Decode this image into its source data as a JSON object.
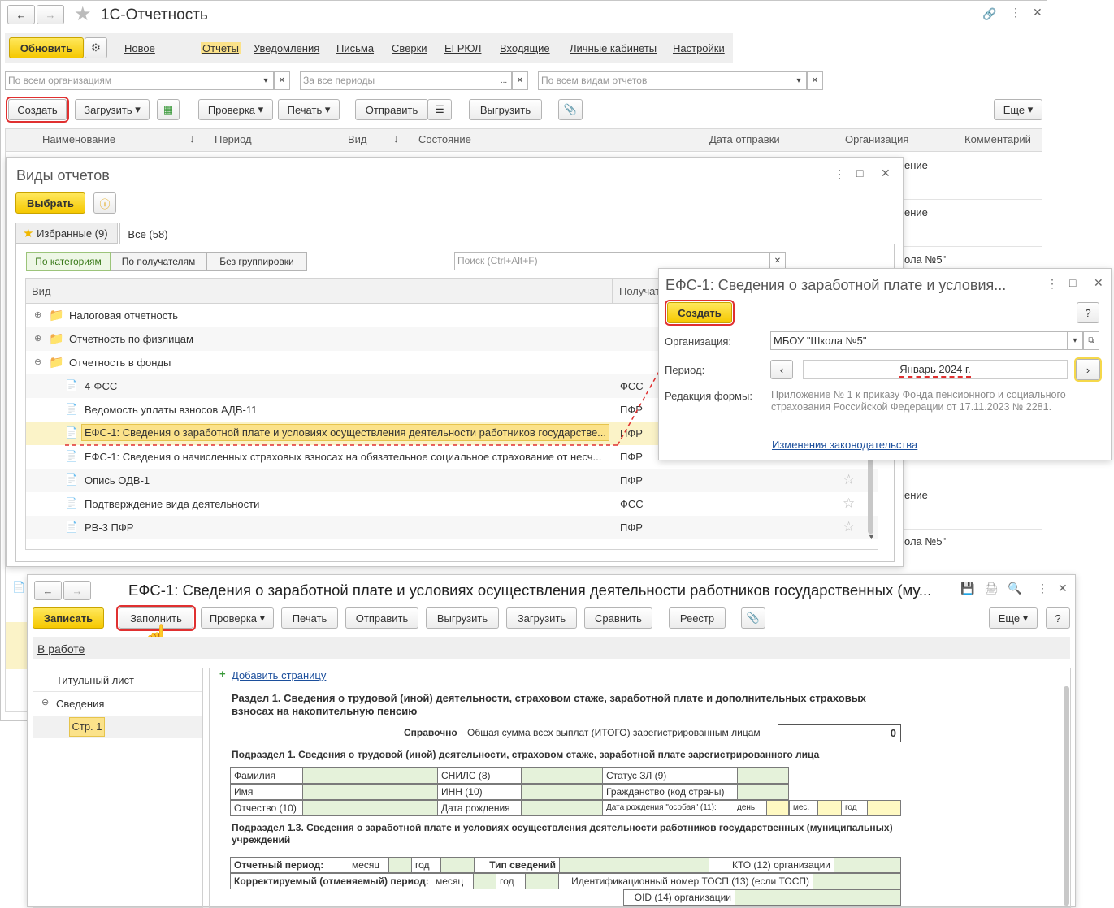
{
  "main": {
    "title": "1С-Отчетность",
    "refresh": "Обновить",
    "tabs": [
      "Новое",
      "Отчеты",
      "Уведомления",
      "Письма",
      "Сверки",
      "ЕГРЮЛ",
      "Входящие",
      "Личные кабинеты",
      "Настройки"
    ],
    "filters": {
      "org": "По всем организациям",
      "period": "За все периоды",
      "kind": "По всем видам отчетов"
    },
    "toolbar": {
      "create": "Создать",
      "load": "Загрузить",
      "check": "Проверка",
      "print": "Печать",
      "send": "Отправить",
      "export": "Выгрузить",
      "more": "Еще"
    },
    "columns": [
      "Наименование",
      "Период",
      "Вид",
      "Состояние",
      "Дата отправки",
      "Организация",
      "Комментарий"
    ],
    "right_fragments": [
      "ение",
      "ение",
      "ола №5\"",
      "ение",
      "ола №5\""
    ]
  },
  "kinds": {
    "title": "Виды отчетов",
    "select": "Выбрать",
    "tab_fav": "Избранные (9)",
    "tab_all": "Все (58)",
    "group_by": [
      "По категориям",
      "По получателям",
      "Без группировки"
    ],
    "search_placeholder": "Поиск (Ctrl+Alt+F)",
    "col_kind": "Вид",
    "col_recipient": "Получатель",
    "folders": [
      "Налоговая отчетность",
      "Отчетность по физлицам",
      "Отчетность в фонды"
    ],
    "items": [
      {
        "name": "4-ФСС",
        "recipient": "ФСС"
      },
      {
        "name": "Ведомость уплаты взносов АДВ-11",
        "recipient": "ПФР"
      },
      {
        "name": "ЕФС-1: Сведения о заработной плате и условиях осуществления деятельности работников государстве...",
        "recipient": "ПФР"
      },
      {
        "name": "ЕФС-1: Сведения о начисленных страховых взносах на обязательное социальное страхование от несч...",
        "recipient": "ПФР"
      },
      {
        "name": "Опись ОДВ-1",
        "recipient": "ПФР"
      },
      {
        "name": "Подтверждение вида деятельности",
        "recipient": "ФСС"
      },
      {
        "name": "РВ-3 ПФР",
        "recipient": "ПФР"
      }
    ]
  },
  "efs_dialog": {
    "title": "ЕФС-1: Сведения о заработной плате и условия...",
    "create": "Создать",
    "help": "?",
    "org_label": "Организация:",
    "org_value": "МБОУ \"Школа №5\"",
    "period_label": "Период:",
    "period_value": "Январь 2024 г.",
    "edition_label": "Редакция формы:",
    "edition_text": "Приложение № 1 к приказу Фонда пенсионного и социального страхования Российской Федерации от 17.11.2023 № 2281.",
    "law_link": "Изменения законодательства"
  },
  "report": {
    "title": "ЕФС-1: Сведения о заработной плате и условиях осуществления деятельности работников государственных (му...",
    "toolbar": {
      "save": "Записать",
      "fill": "Заполнить",
      "check": "Проверка",
      "print": "Печать",
      "send": "Отправить",
      "export": "Выгрузить",
      "load": "Загрузить",
      "compare": "Сравнить",
      "registry": "Реестр",
      "more": "Еще",
      "help": "?"
    },
    "status": "В работе",
    "tree": {
      "title_page": "Титульный лист",
      "section": "Сведения",
      "page": "Стр. 1"
    },
    "add_page": "Добавить страницу",
    "section1": "Раздел 1. Сведения о трудовой (иной) деятельности, страховом стаже, заработной плате и дополнительных страховых взносах на накопительную пенсию",
    "ref_label": "Справочно",
    "ref_text": "Общая сумма всех выплат (ИТОГО) зарегистрированным лицам",
    "ref_value": "0",
    "sub1": "Подраздел 1. Сведения о трудовой (иной) деятельности, страховом стаже, заработной плате зарегистрированного лица",
    "grid1": {
      "surname": "Фамилия",
      "snils": "СНИЛС (8)",
      "status": "Статус ЗЛ (9)",
      "name": "Имя",
      "inn": "ИНН (10)",
      "citizenship": "Гражданство (код страны)",
      "patronymic": "Отчество (10)",
      "birthdate": "Дата рождения",
      "special": "Дата рождения \"особая\" (11):",
      "day": "день",
      "month": "мес.",
      "year": "год"
    },
    "sub13": "Подраздел 1.3.  Сведения о заработной плате и условиях осуществления деятельности работников государственных (муниципальных) учреждений",
    "grid2": {
      "period": "Отчетный период:",
      "month": "месяц",
      "year": "год",
      "type": "Тип сведений",
      "kto": "КТО (12) организации",
      "corr": "Корректируемый (отменяемый) период:",
      "tosp": "Идентификационный номер ТОСП (13) (если ТОСП)",
      "oid": "OID (14) организации"
    }
  }
}
